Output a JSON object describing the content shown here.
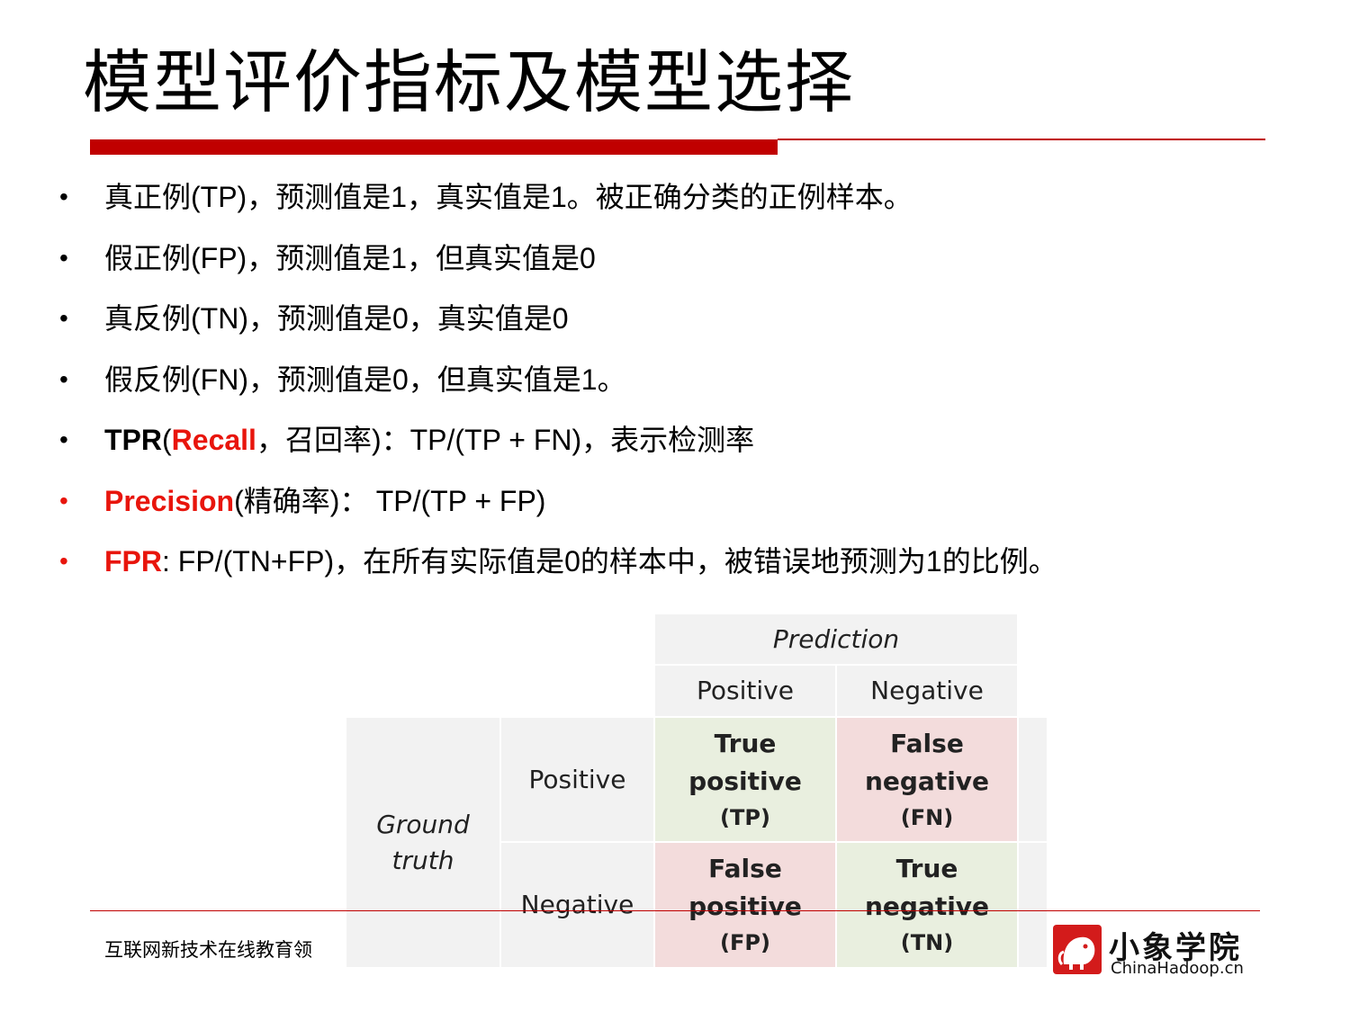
{
  "slide": {
    "title": "模型评价指标及模型选择",
    "bullets": [
      {
        "text": "真正例(TP)，预测值是1，真实值是1。被正确分类的正例样本。"
      },
      {
        "text": "假正例(FP)，预测值是1，但真实值是0"
      },
      {
        "text": "真反例(TN)，预测值是0，真实值是0"
      },
      {
        "text": "假反例(FN)，预测值是0，但真实值是1。"
      },
      {
        "parts": [
          "TPR",
          "(",
          "Recall",
          "，召回率)：TP/(TP + FN)，表示检测率"
        ]
      },
      {
        "parts": [
          "Precision",
          "(精确率)：  TP/(TP + FP)"
        ]
      },
      {
        "parts": [
          "FPR",
          ": FP/(TN+FP)，在所有实际值是0的样本中，被错误地预测为1的比例。"
        ]
      }
    ],
    "colors": {
      "accent_red": "#c00000",
      "highlight_red": "#e8150c"
    }
  },
  "matrix": {
    "prediction_label": "Prediction",
    "ground_truth_label": [
      "Ground",
      "truth"
    ],
    "col_headers": [
      "Positive",
      "Negative"
    ],
    "row_headers": [
      "Positive",
      "Negative"
    ],
    "cells": [
      [
        {
          "line1": "True",
          "line2": "positive",
          "abbr": "(TP)"
        },
        {
          "line1": "False",
          "line2": "negative",
          "abbr": "(FN)"
        }
      ],
      [
        {
          "line1": "False",
          "line2": "positive",
          "abbr": "(FP)"
        },
        {
          "line1": "True",
          "line2": "negative",
          "abbr": "(TN)"
        }
      ]
    ]
  },
  "footer": {
    "text": "互联网新技术在线教育领",
    "logo_cn": "小象学院",
    "logo_en": "ChinaHadoop.cn"
  }
}
